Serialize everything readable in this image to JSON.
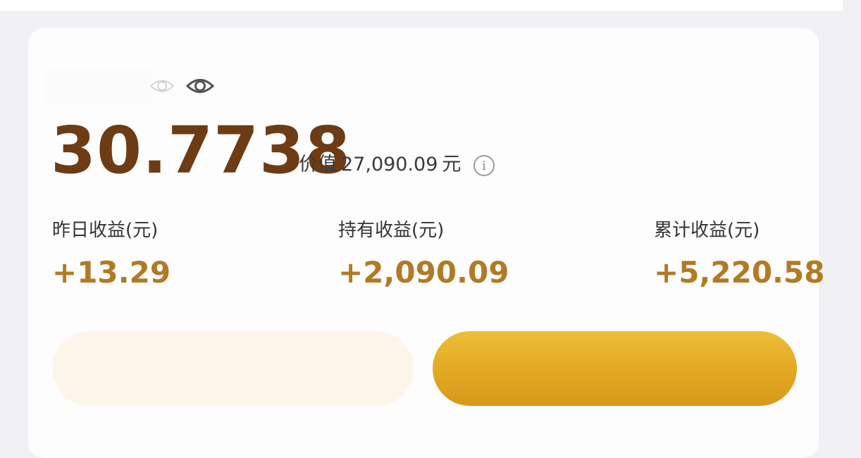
{
  "account": {
    "balance": "30.7738",
    "value_label": "价值",
    "value_amount": "27,090.09",
    "value_unit": "元",
    "info_icon": "info-icon",
    "visibility_icon": "eye-icon"
  },
  "stats": {
    "yesterday": {
      "label": "昨日收益(元)",
      "value": "+13.29"
    },
    "holding": {
      "label": "持有收益(元)",
      "value": "+2,090.09"
    },
    "total": {
      "label": "累计收益(元)",
      "value": "+5,220.58"
    }
  },
  "actions": {
    "left_button": {
      "label": "",
      "color": "#fdf5ea"
    },
    "right_button": {
      "label": "",
      "color": "#e3a822"
    }
  },
  "colors": {
    "balance": "#6e3c14",
    "gain": "#b27a24",
    "accent": "#e3a822"
  }
}
